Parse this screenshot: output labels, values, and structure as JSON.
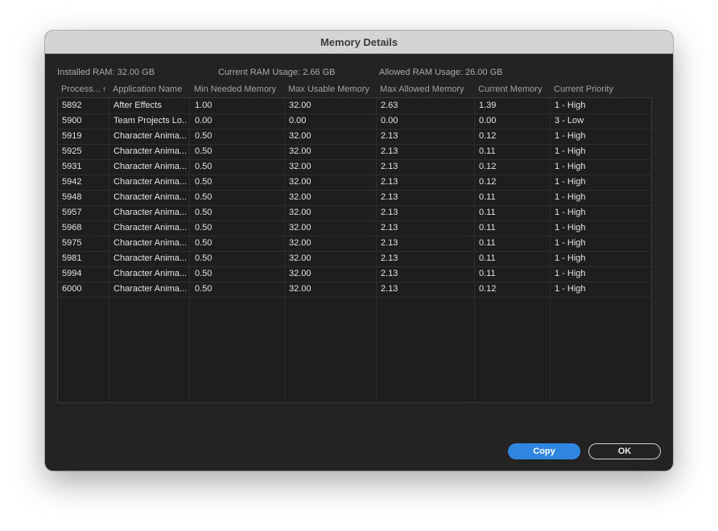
{
  "window": {
    "title": "Memory Details"
  },
  "summary": {
    "installed": "Installed RAM: 32.00 GB",
    "current": "Current RAM Usage: 2.66 GB",
    "allowed": "Allowed RAM Usage: 26.00 GB"
  },
  "table": {
    "headers": [
      "Process...",
      "Application Name",
      "Min Needed Memory",
      "Max Usable Memory",
      "Max Allowed Memory",
      "Current Memory",
      "Current Priority"
    ],
    "sort_icon": "arrow-up-icon",
    "rows": [
      [
        "5892",
        "After Effects",
        "1.00",
        "32.00",
        "2.63",
        "1.39",
        "1 - High"
      ],
      [
        "5900",
        "Team Projects Lo...",
        "0.00",
        "0.00",
        "0.00",
        "0.00",
        "3 - Low"
      ],
      [
        "5919",
        "Character Anima...",
        "0.50",
        "32.00",
        "2.13",
        "0.12",
        "1 - High"
      ],
      [
        "5925",
        "Character Anima...",
        "0.50",
        "32.00",
        "2.13",
        "0.11",
        "1 - High"
      ],
      [
        "5931",
        "Character Anima...",
        "0.50",
        "32.00",
        "2.13",
        "0.12",
        "1 - High"
      ],
      [
        "5942",
        "Character Anima...",
        "0.50",
        "32.00",
        "2.13",
        "0.12",
        "1 - High"
      ],
      [
        "5948",
        "Character Anima...",
        "0.50",
        "32.00",
        "2.13",
        "0.11",
        "1 - High"
      ],
      [
        "5957",
        "Character Anima...",
        "0.50",
        "32.00",
        "2.13",
        "0.11",
        "1 - High"
      ],
      [
        "5968",
        "Character Anima...",
        "0.50",
        "32.00",
        "2.13",
        "0.11",
        "1 - High"
      ],
      [
        "5975",
        "Character Anima...",
        "0.50",
        "32.00",
        "2.13",
        "0.11",
        "1 - High"
      ],
      [
        "5981",
        "Character Anima...",
        "0.50",
        "32.00",
        "2.13",
        "0.11",
        "1 - High"
      ],
      [
        "5994",
        "Character Anima...",
        "0.50",
        "32.00",
        "2.13",
        "0.11",
        "1 - High"
      ],
      [
        "6000",
        "Character Anima...",
        "0.50",
        "32.00",
        "2.13",
        "0.12",
        "1 - High"
      ]
    ]
  },
  "buttons": {
    "copy": "Copy",
    "ok": "OK"
  },
  "colors": {
    "accent": "#2e86de",
    "window_bg": "#232323",
    "titlebar_bg": "#d6d3d6"
  }
}
